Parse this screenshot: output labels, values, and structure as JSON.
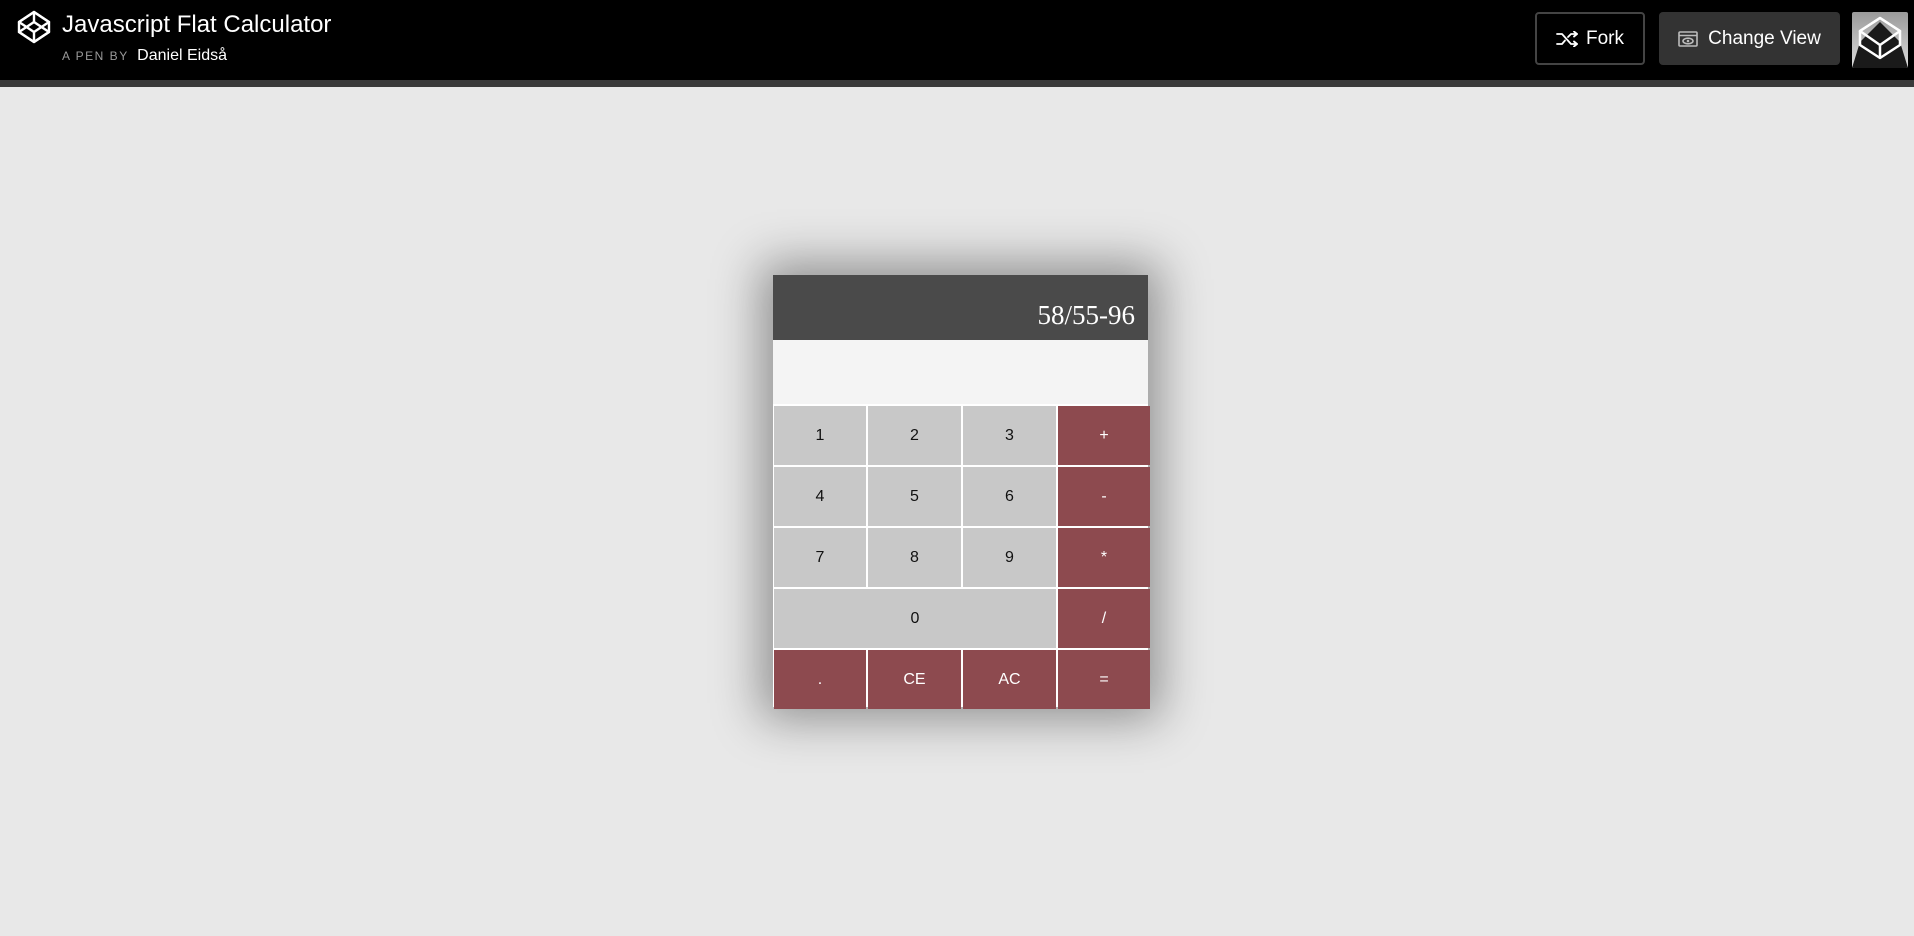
{
  "header": {
    "title": "Javascript Flat Calculator",
    "by_label": "A PEN BY",
    "author": "Daniel Eidså",
    "fork_label": "Fork",
    "change_view_label": "Change View",
    "logo_icon": "codepen-logo-icon",
    "fork_icon": "fork-icon",
    "view_icon": "eye-window-icon"
  },
  "calculator": {
    "display": "58/55-96",
    "display_secondary": "",
    "keys": {
      "k1": "1",
      "k2": "2",
      "k3": "3",
      "plus": "+",
      "k4": "4",
      "k5": "5",
      "k6": "6",
      "minus": "-",
      "k7": "7",
      "k8": "8",
      "k9": "9",
      "multiply": "*",
      "k0": "0",
      "divide": "/",
      "dot": ".",
      "ce": "CE",
      "ac": "AC",
      "equals": "="
    }
  },
  "colors": {
    "topbar": "#000000",
    "page_bg": "#e8e8e8",
    "display_bg": "#4a4a4a",
    "number_key": "#c8c8c8",
    "operator_key": "#8d4a4f"
  }
}
